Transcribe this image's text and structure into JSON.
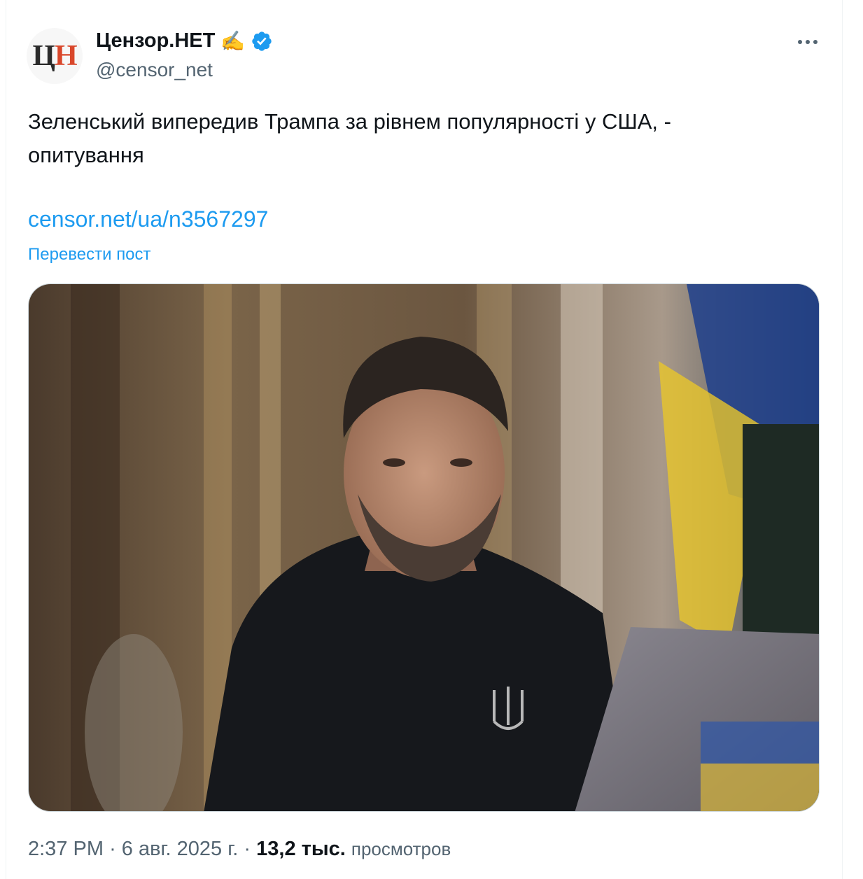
{
  "author": {
    "avatar_text_1": "Ц",
    "avatar_text_2": "Н",
    "display_name": "Цензор.НЕТ",
    "emoji": "✍️",
    "handle": "@censor_net"
  },
  "tweet": {
    "text": "Зеленський випередив Трампа за рівнем популярності у США, -\nопитування",
    "link": "censor.net/ua/n3567297",
    "translate_label": "Перевести пост"
  },
  "meta": {
    "time": "2:37 PM",
    "separator": "·",
    "date": "6 авг. 2025 г.",
    "views_count": "13,2 тыс.",
    "views_label": "просмотров"
  },
  "colors": {
    "accent": "#1d9bf0",
    "secondary_text": "#536471",
    "primary_text": "#0f1419",
    "verified": "#1d9bf0"
  },
  "icons": {
    "verified": "verified-badge-icon",
    "more": "more-options-icon"
  }
}
